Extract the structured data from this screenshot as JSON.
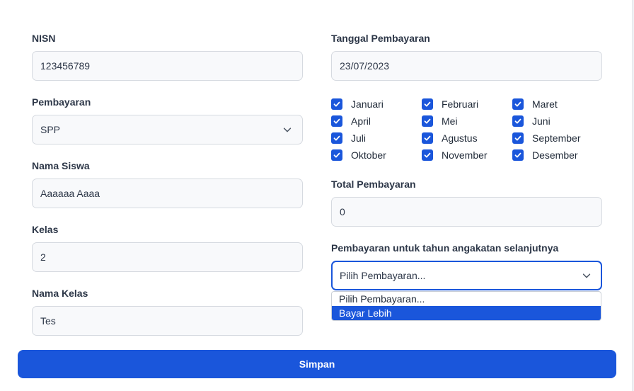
{
  "form": {
    "nisn": {
      "label": "NISN",
      "value": "123456789"
    },
    "pembayaran": {
      "label": "Pembayaran",
      "value": "SPP"
    },
    "nama_siswa": {
      "label": "Nama Siswa",
      "value": "Aaaaaa Aaaa"
    },
    "kelas": {
      "label": "Kelas",
      "value": "2"
    },
    "nama_kelas": {
      "label": "Nama Kelas",
      "value": "Tes"
    },
    "tanggal": {
      "label": "Tanggal Pembayaran",
      "value": "23/07/2023"
    },
    "months": [
      {
        "label": "Januari",
        "checked": true
      },
      {
        "label": "Februari",
        "checked": true
      },
      {
        "label": "Maret",
        "checked": true
      },
      {
        "label": "April",
        "checked": true
      },
      {
        "label": "Mei",
        "checked": true
      },
      {
        "label": "Juni",
        "checked": true
      },
      {
        "label": "Juli",
        "checked": true
      },
      {
        "label": "Agustus",
        "checked": true
      },
      {
        "label": "September",
        "checked": true
      },
      {
        "label": "Oktober",
        "checked": true
      },
      {
        "label": "November",
        "checked": true
      },
      {
        "label": "Desember",
        "checked": true
      }
    ],
    "total": {
      "label": "Total Pembayaran",
      "value": "0"
    },
    "next_year": {
      "label": "Pembayaran untuk tahun angakatan selanjutnya",
      "value": "Pilih Pembayaran...",
      "options": [
        "Pilih Pembayaran...",
        "Bayar Lebih"
      ],
      "highlighted_option": "Bayar Lebih"
    },
    "submit_label": "Simpan"
  },
  "colors": {
    "primary": "#1a56db",
    "field_bg": "#f8f9fb",
    "field_border": "#d6dae0"
  }
}
